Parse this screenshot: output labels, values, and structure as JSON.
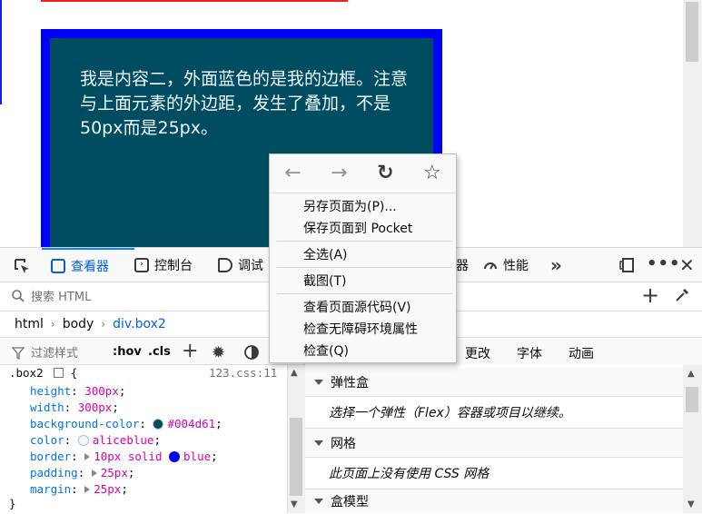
{
  "page": {
    "content_text": "我是内容二，外面蓝色的是我的边框。注意与上面元素的外边距，发生了叠加，不是50px而是25px。"
  },
  "devtools": {
    "tabs": [
      {
        "label": "查看器",
        "icon": "inspector-icon",
        "selected": true
      },
      {
        "label": "控制台",
        "icon": "console-icon"
      },
      {
        "label": "调试",
        "icon": "debugger-icon"
      },
      {
        "label": "器",
        "icon": ""
      },
      {
        "label": "性能",
        "icon": "performance-icon"
      }
    ],
    "search_placeholder": "搜索 HTML",
    "breadcrumb": [
      "html",
      "body",
      "div.box2"
    ],
    "rules_toolbar": {
      "filter_placeholder": "过滤样式",
      "hov_label": ":hov",
      "cls_label": ".cls"
    },
    "side_tabs": [
      "更改",
      "字体",
      "动画"
    ],
    "rule": {
      "selector": ".box2",
      "source": "123.css:11",
      "declarations": [
        {
          "prop": "height",
          "value": "300px",
          "swatch": null,
          "expandable": false
        },
        {
          "prop": "width",
          "value": "300px",
          "swatch": null,
          "expandable": false
        },
        {
          "prop": "background-color",
          "value": "#004d61",
          "swatch": "#004d61",
          "expandable": false
        },
        {
          "prop": "color",
          "value": "aliceblue",
          "swatch": "#f0f8ff",
          "expandable": false
        },
        {
          "prop": "border",
          "value": "10px solid",
          "value2": "blue",
          "swatch2": "#0000ff",
          "expandable": true
        },
        {
          "prop": "padding",
          "value": "25px",
          "swatch": null,
          "expandable": true
        },
        {
          "prop": "margin",
          "value": "25px",
          "swatch": null,
          "expandable": true
        }
      ],
      "close_brace": "}"
    },
    "layout_sections": [
      {
        "title": "弹性盒",
        "body": "选择一个弹性（Flex）容器或项目以继续。"
      },
      {
        "title": "网格",
        "body": "此页面上没有使用 CSS 网格"
      },
      {
        "title": "盒模型",
        "body": ""
      }
    ]
  },
  "context_menu": {
    "items": [
      {
        "label": "另存页面为(P)...",
        "group": 1
      },
      {
        "label": "保存页面到 Pocket",
        "group": 1
      },
      {
        "label": "全选(A)",
        "group": 2
      },
      {
        "label": "截图(T)",
        "group": 3
      },
      {
        "label": "查看页面源代码(V)",
        "group": 4
      },
      {
        "label": "检查无障碍环境属性",
        "group": 4
      },
      {
        "label": "检查(Q)",
        "group": 4
      }
    ]
  },
  "colors": {
    "box_background": "#004d61",
    "box_border": "#0000ff",
    "accent": "#0060df"
  }
}
